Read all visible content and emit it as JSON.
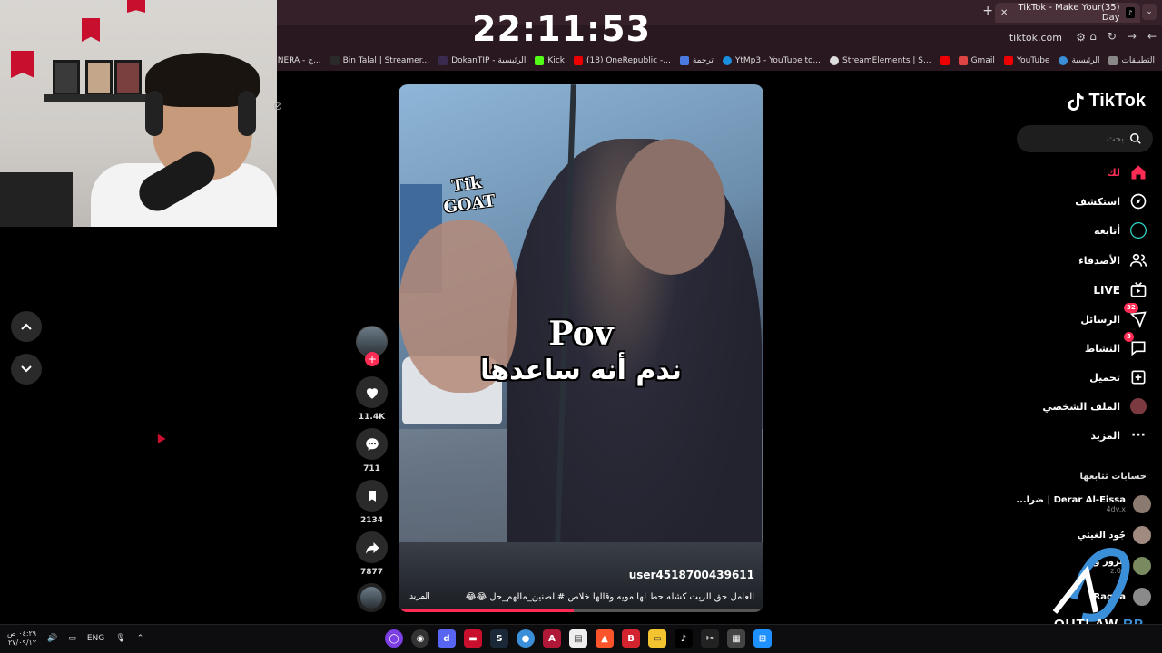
{
  "clock": "22:11:53",
  "browser": {
    "tab_title": "(35)TikTok - Make Your Day",
    "url": "tiktok.com",
    "bookmarks": [
      "التطبيقات",
      "الرئيسية",
      "YouTube",
      "Gmail",
      "",
      "StreamElements | S...",
      "YtMp3 - YouTube to...",
      "ترجمة",
      "(18) OneRepublic -...",
      "Kick",
      "DokanTIP - الرئيسية",
      "Bin Talal | Streamer...",
      "#STRADA NERA - ج..."
    ]
  },
  "video": {
    "watermark_line1": "Tik",
    "watermark_line2": "GOAT",
    "overlay_title": "Pov",
    "overlay_subtitle": "ندم أنه ساعدها",
    "username": "user4518700439611",
    "caption": "العامل حق الزيت كشله حط لها مويه وقالها خلاص #الصنين_مالهم_حل 😂😂 ...",
    "more_label": "المزيد",
    "progress": 0.48
  },
  "actions": {
    "likes": "11.4K",
    "comments": "711",
    "saves": "2134",
    "shares": "7877"
  },
  "sidebar": {
    "brand": "TikTok",
    "search_placeholder": "بحث",
    "nav": [
      {
        "label": "لك",
        "icon": "home-icon"
      },
      {
        "label": "استكشف",
        "icon": "compass-icon"
      },
      {
        "label": "أتابعه",
        "icon": "following-icon"
      },
      {
        "label": "الأصدقاء",
        "icon": "friends-icon"
      },
      {
        "label": "LIVE",
        "icon": "live-icon"
      },
      {
        "label": "الرسائل",
        "icon": "messages-icon",
        "badge": "32"
      },
      {
        "label": "النشاط",
        "icon": "activity-icon",
        "badge": "3"
      },
      {
        "label": "تحميل",
        "icon": "upload-icon"
      },
      {
        "label": "الملف الشخصي",
        "icon": "profile-icon"
      },
      {
        "label": "المزيد",
        "icon": "more-icon"
      }
    ],
    "following_title": "حسابات تتابعها",
    "accounts": [
      {
        "name": "Derar Al-Eissa | ضرا...",
        "sub": "4dv.x"
      },
      {
        "name": "جُود الغيثي",
        "sub": ""
      },
      {
        "name": "عزوز و",
        "sub": "z.02"
      },
      {
        "name": "Ragha",
        "sub": ""
      }
    ]
  },
  "overlay_logo": {
    "text_a": "OUTLAW",
    "text_b": "RP"
  },
  "taskbar": {
    "time": "٠٤:٢٩ ص",
    "date": "٢٧/٠٩/١٢",
    "lang": "ENG"
  },
  "colors": {
    "accent": "#fe2c55",
    "tab_bg": "#35202a",
    "bg": "#000000"
  }
}
